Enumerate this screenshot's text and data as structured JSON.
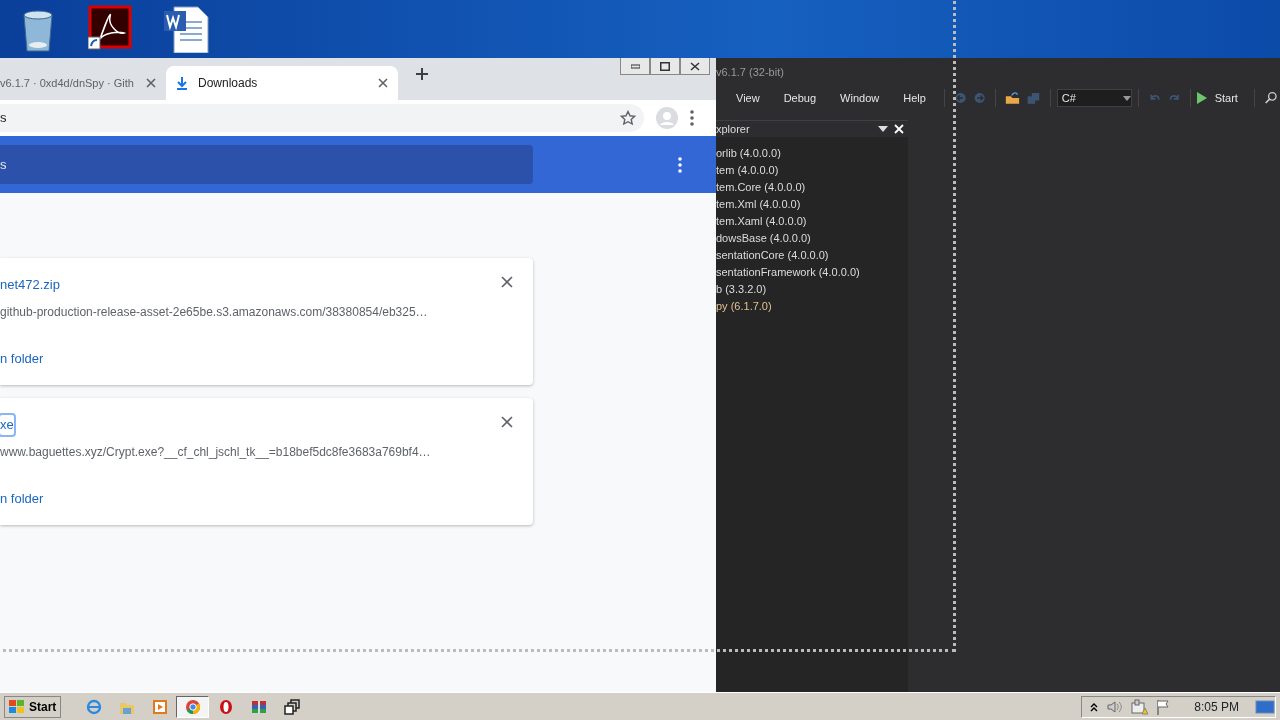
{
  "desktop_icons": [
    {
      "kind": "recycle-bin"
    },
    {
      "kind": "pdf-shortcut"
    },
    {
      "kind": "word-document"
    }
  ],
  "browser": {
    "tabs": [
      {
        "title": "v6.1.7 · 0xd4d/dnSpy · Gith",
        "selected": false
      },
      {
        "title": "Downloads",
        "selected": true
      }
    ],
    "address": "s",
    "header_search": "s",
    "downloads": [
      {
        "file_name": "net472.zip",
        "url": "github-production-release-asset-2e65be.s3.amazonaws.com/38380854/eb325…",
        "action": "n folder",
        "focused": false
      },
      {
        "file_name": "xe",
        "url": "www.baguettes.xyz/Crypt.exe?__cf_chl_jschl_tk__=b18bef5dc8fe3683a769bf4…",
        "action": "n folder",
        "focused": true
      }
    ]
  },
  "dnspy": {
    "title": "v6.1.7 (32-bit)",
    "menu": [
      "View",
      "Debug",
      "Window",
      "Help"
    ],
    "language": "C#",
    "start_button": "Start",
    "explorer": {
      "title": "xplorer",
      "items": [
        {
          "label": "orlib (4.0.0.0)",
          "color": "#dcdcdc"
        },
        {
          "label": "tem (4.0.0.0)",
          "color": "#dcdcdc"
        },
        {
          "label": "tem.Core (4.0.0.0)",
          "color": "#dcdcdc"
        },
        {
          "label": "tem.Xml (4.0.0.0)",
          "color": "#dcdcdc"
        },
        {
          "label": "tem.Xaml (4.0.0.0)",
          "color": "#dcdcdc"
        },
        {
          "label": "dowsBase (4.0.0.0)",
          "color": "#dcdcdc"
        },
        {
          "label": "sentationCore (4.0.0.0)",
          "color": "#dcdcdc"
        },
        {
          "label": "sentationFramework (4.0.0.0)",
          "color": "#dcdcdc"
        },
        {
          "label": "b (3.3.2.0)",
          "color": "#dcdcdc"
        },
        {
          "label": "py (6.1.7.0)",
          "color": "#e2c08d"
        }
      ]
    }
  },
  "taskbar": {
    "start": "Start",
    "apps": [
      {
        "kind": "ie",
        "selected": false
      },
      {
        "kind": "folder",
        "selected": false
      },
      {
        "kind": "media",
        "selected": false
      },
      {
        "kind": "chrome",
        "selected": true
      },
      {
        "kind": "opera",
        "selected": false
      },
      {
        "kind": "archive",
        "selected": false
      },
      {
        "kind": "switch",
        "selected": false
      }
    ],
    "clock": "8:05 PM"
  }
}
